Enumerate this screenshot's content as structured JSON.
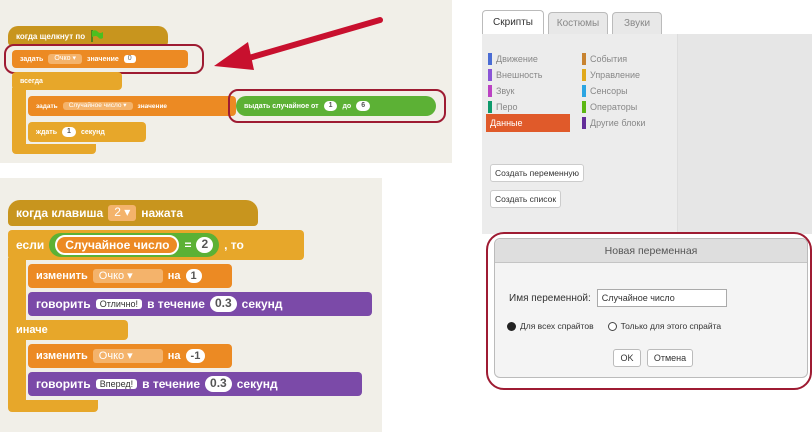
{
  "top_script": {
    "hat": "когда щелкнут по",
    "set_label": "задать",
    "set_var": "Очко",
    "set_value_label": "значение",
    "set_value": "0",
    "forever": "всегда",
    "inner_set_label": "задать",
    "inner_set_var": "Случайное число",
    "inner_set_value_label": "значение",
    "random_label": "выдать случайное от",
    "random_from": "1",
    "random_to_label": "до",
    "random_to": "6",
    "wait_label": "ждать",
    "wait_value": "1",
    "wait_unit": "секунд"
  },
  "bottom_script": {
    "hat_prefix": "когда клавиша",
    "hat_key": "2",
    "hat_suffix": "нажата",
    "if_label": "если",
    "if_var": "Случайное число",
    "if_op": "=",
    "if_value": "2",
    "if_then": ", то",
    "change1_label": "изменить",
    "change1_var": "Очко",
    "change1_on": "на",
    "change1_value": "1",
    "say1_label": "говорить",
    "say1_text": "Отлично!",
    "say1_during": "в течение",
    "say1_time": "0.3",
    "say1_unit": "секунд",
    "else_label": "иначе",
    "change2_label": "изменить",
    "change2_var": "Очко",
    "change2_on": "на",
    "change2_value": "-1",
    "say2_label": "говорить",
    "say2_text": "Вперед!",
    "say2_during": "в течение",
    "say2_time": "0.3",
    "say2_unit": "секунд"
  },
  "editor": {
    "tabs": [
      "Скрипты",
      "Костюмы",
      "Звуки"
    ],
    "categories_left": [
      {
        "label": "Движение",
        "color": "#4a6cd4"
      },
      {
        "label": "Внешность",
        "color": "#8a55d7"
      },
      {
        "label": "Звук",
        "color": "#bb42c3"
      },
      {
        "label": "Перо",
        "color": "#0e9a6c"
      },
      {
        "label": "Данные",
        "color": "#ee7d16"
      }
    ],
    "categories_right": [
      {
        "label": "События",
        "color": "#c88330"
      },
      {
        "label": "Управление",
        "color": "#e1a91a"
      },
      {
        "label": "Сенсоры",
        "color": "#2ca5e2"
      },
      {
        "label": "Операторы",
        "color": "#5cb712"
      },
      {
        "label": "Другие блоки",
        "color": "#632d99"
      }
    ],
    "create_variable_button": "Создать переменную",
    "create_list_button": "Создать список"
  },
  "dialog": {
    "title": "Новая переменная",
    "name_label": "Имя переменной:",
    "name_value": "Случайное число",
    "radio_all": "Для всех спрайтов",
    "radio_this": "Только для этого спрайта",
    "ok_button": "OK",
    "cancel_button": "Отмена"
  }
}
